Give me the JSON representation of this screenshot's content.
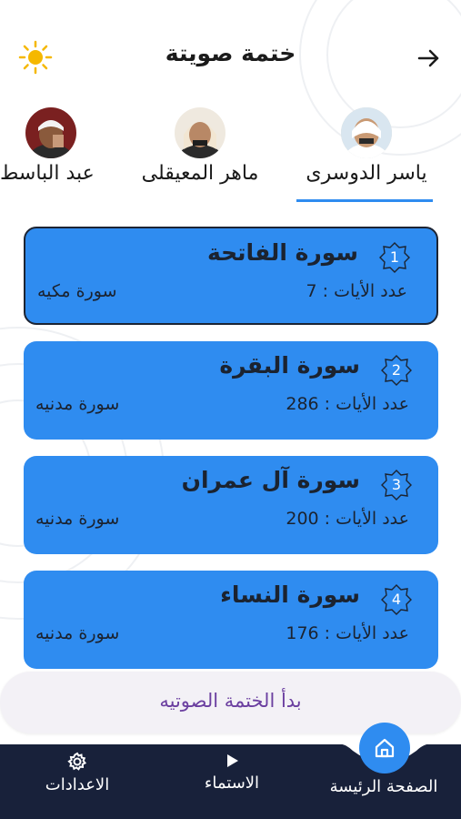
{
  "header": {
    "title": "ختمة صويتة"
  },
  "reciters": [
    {
      "name": "ياسر الدوسرى",
      "selected": true
    },
    {
      "name": "ماهر المعيقلى",
      "selected": false
    },
    {
      "name": "عبد الباسط",
      "selected": false
    }
  ],
  "surahs": [
    {
      "number": "1",
      "name": "سورة الفاتحة",
      "ayat": "عدد الأيات : 7",
      "type": "سورة مكيه"
    },
    {
      "number": "2",
      "name": "سورة البقرة",
      "ayat": "عدد الأيات : 286",
      "type": "سورة مدنيه"
    },
    {
      "number": "3",
      "name": "سورة آل عمران",
      "ayat": "عدد الأيات : 200",
      "type": "سورة مدنيه"
    },
    {
      "number": "4",
      "name": "سورة النساء",
      "ayat": "عدد الأيات : 176",
      "type": "سورة مدنيه"
    }
  ],
  "start_button": {
    "label": "بدأ الختمة الصوتيه"
  },
  "bottom_nav": {
    "home": "الصفحة الرئيسة",
    "listen": "الاستماء",
    "settings": "الاعدادات"
  },
  "colors": {
    "card": "#2f8cf0",
    "nav": "#18213a",
    "accent": "#2f8cf0",
    "sun": "#f5b800",
    "start_text": "#6b3fa0"
  }
}
